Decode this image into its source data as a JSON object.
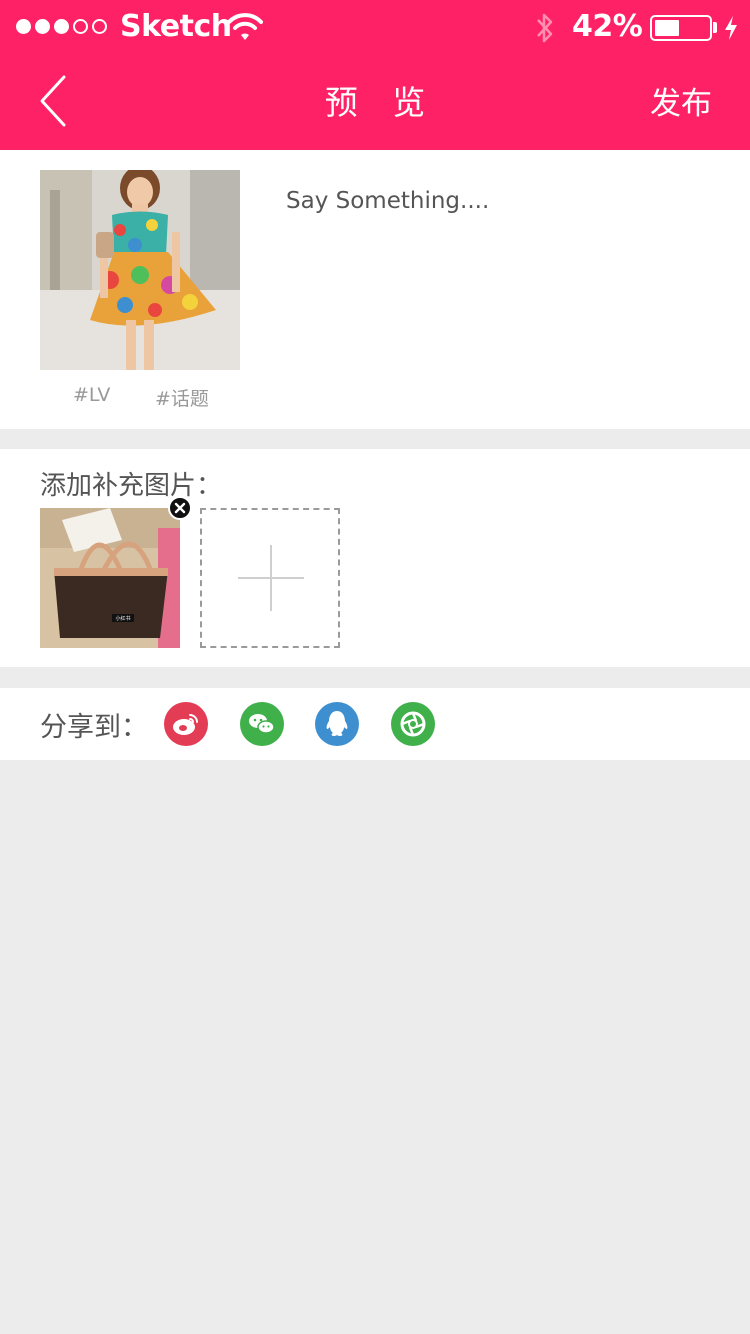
{
  "status_bar": {
    "carrier": "Sketch",
    "battery_percent": "42%",
    "battery_level": 0.42,
    "signal_bars_filled": 3,
    "signal_bars_total": 5
  },
  "nav": {
    "title": "预 览",
    "publish_label": "发布",
    "back_icon": "chevron-left-icon"
  },
  "post": {
    "caption_placeholder": "Say Something....",
    "tags": [
      "#LV",
      "#话题"
    ]
  },
  "add_images": {
    "label": "添加补充图片：",
    "thumb_badge": "小红书"
  },
  "share": {
    "label": "分享到：",
    "targets": [
      "weibo-icon",
      "wechat-icon",
      "qq-icon",
      "moments-icon"
    ]
  },
  "colors": {
    "brand": "#ff2166",
    "weibo": "#e33c55",
    "wechat": "#3fb04a",
    "qq": "#3d8fd0",
    "background": "#ececec"
  }
}
